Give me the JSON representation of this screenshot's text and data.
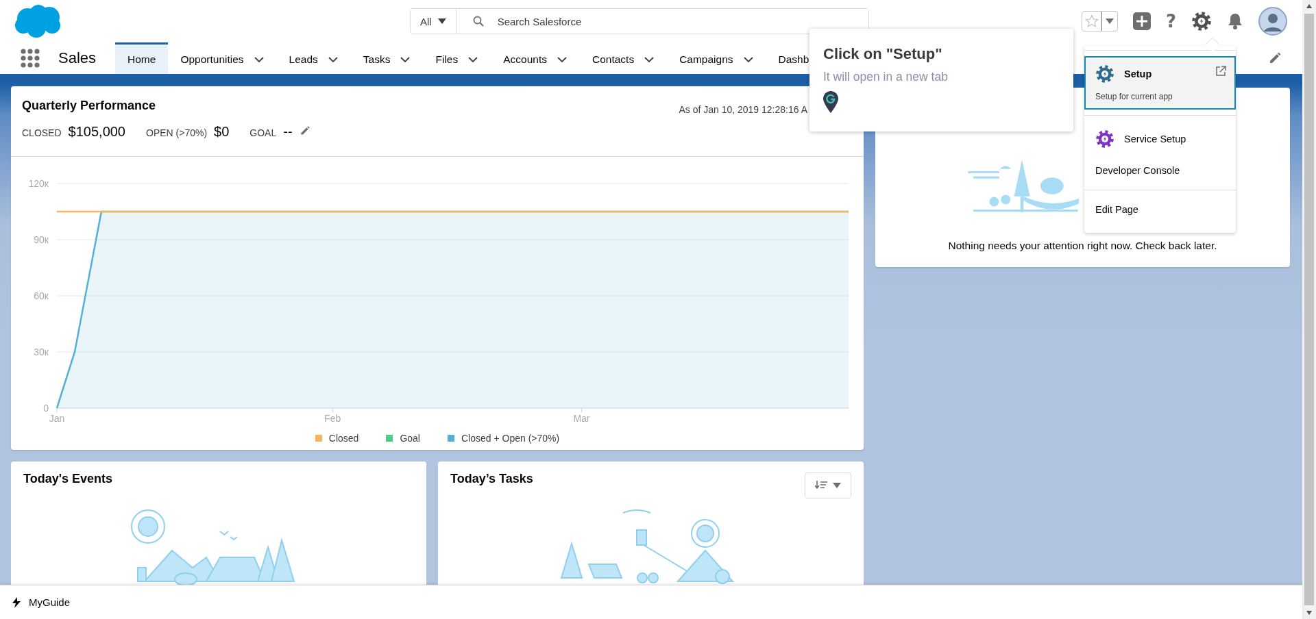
{
  "header": {
    "search_scope": "All",
    "search_placeholder": "Search Salesforce",
    "help_label": "?"
  },
  "nav": {
    "app_name": "Sales",
    "tabs": [
      {
        "label": "Home",
        "selected": true,
        "has_menu": false
      },
      {
        "label": "Opportunities",
        "selected": false,
        "has_menu": true
      },
      {
        "label": "Leads",
        "selected": false,
        "has_menu": true
      },
      {
        "label": "Tasks",
        "selected": false,
        "has_menu": true
      },
      {
        "label": "Files",
        "selected": false,
        "has_menu": true
      },
      {
        "label": "Accounts",
        "selected": false,
        "has_menu": true
      },
      {
        "label": "Contacts",
        "selected": false,
        "has_menu": true
      },
      {
        "label": "Campaigns",
        "selected": false,
        "has_menu": true
      },
      {
        "label": "Dashb",
        "selected": false,
        "has_menu": false
      }
    ]
  },
  "quarterly_performance": {
    "title": "Quarterly Performance",
    "as_of": "As of Jan 10, 2019 12:28:16 A",
    "metrics": [
      {
        "label": "CLOSED",
        "value": "$105,000",
        "editable": false
      },
      {
        "label": "OPEN (>70%)",
        "value": "$0",
        "editable": false
      },
      {
        "label": "GOAL",
        "value": "--",
        "editable": true
      }
    ],
    "chart_data": {
      "type": "line",
      "grid": true,
      "legend": true,
      "categories": [
        "Jan",
        null,
        null,
        null,
        null,
        null,
        null,
        null,
        null,
        null,
        null,
        null,
        null,
        null,
        null,
        null,
        null,
        null,
        null,
        null,
        null,
        null,
        null,
        null,
        null,
        null,
        null,
        null,
        null,
        null,
        null,
        "Feb",
        null,
        null,
        null,
        null,
        null,
        null,
        null,
        null,
        null,
        null,
        null,
        null,
        null,
        null,
        null,
        null,
        null,
        null,
        null,
        null,
        null,
        null,
        null,
        null,
        null,
        null,
        null,
        "Mar",
        null,
        null,
        null,
        null,
        null,
        null,
        null,
        null,
        null,
        null,
        null,
        null,
        null,
        null,
        null,
        null,
        null,
        null,
        null,
        null,
        null,
        null,
        null,
        null,
        null,
        null,
        null,
        null,
        null,
        null
      ],
      "series": [
        {
          "name": "Closed",
          "color": "#f4b660",
          "values": [
            105,
            105,
            105,
            105,
            105,
            105,
            105,
            105,
            105,
            105,
            105,
            105,
            105,
            105,
            105,
            105,
            105,
            105,
            105,
            105,
            105,
            105,
            105,
            105,
            105,
            105,
            105,
            105,
            105,
            105,
            105,
            105,
            105,
            105,
            105,
            105,
            105,
            105,
            105,
            105,
            105,
            105,
            105,
            105,
            105,
            105,
            105,
            105,
            105,
            105,
            105,
            105,
            105,
            105,
            105,
            105,
            105,
            105,
            105,
            105,
            105,
            105,
            105,
            105,
            105,
            105,
            105,
            105,
            105,
            105,
            105,
            105,
            105,
            105,
            105,
            105,
            105,
            105,
            105,
            105,
            105,
            105,
            105,
            105,
            105,
            105,
            105,
            105,
            105,
            105
          ]
        },
        {
          "name": "Goal",
          "color": "#4bca81",
          "values": [
            null,
            null,
            null,
            null,
            null,
            null,
            null,
            null,
            null,
            null,
            null,
            null,
            null,
            null,
            null,
            null,
            null,
            null,
            null,
            null,
            null,
            null,
            null,
            null,
            null,
            null,
            null,
            null,
            null,
            null,
            null,
            null,
            null,
            null,
            null,
            null,
            null,
            null,
            null,
            null,
            null,
            null,
            null,
            null,
            null,
            null,
            null,
            null,
            null,
            null,
            null,
            null,
            null,
            null,
            null,
            null,
            null,
            null,
            null,
            null,
            null,
            null,
            null,
            null,
            null,
            null,
            null,
            null,
            null,
            null,
            null,
            null,
            null,
            null,
            null,
            null,
            null,
            null,
            null,
            null,
            null,
            null,
            null,
            null,
            null,
            null,
            null,
            null,
            null,
            null
          ]
        },
        {
          "name": "Closed + Open (>70%)",
          "type": "area",
          "color": "#54b0d4",
          "values": [
            0,
            15,
            30,
            55,
            80,
            105,
            105,
            105,
            105,
            105,
            105,
            105,
            105,
            105,
            105,
            105,
            105,
            105,
            105,
            105,
            105,
            105,
            105,
            105,
            105,
            105,
            105,
            105,
            105,
            105,
            105,
            105,
            105,
            105,
            105,
            105,
            105,
            105,
            105,
            105,
            105,
            105,
            105,
            105,
            105,
            105,
            105,
            105,
            105,
            105,
            105,
            105,
            105,
            105,
            105,
            105,
            105,
            105,
            105,
            105,
            105,
            105,
            105,
            105,
            105,
            105,
            105,
            105,
            105,
            105,
            105,
            105,
            105,
            105,
            105,
            105,
            105,
            105,
            105,
            105,
            105,
            105,
            105,
            105,
            105,
            105,
            105,
            105,
            105,
            105
          ]
        }
      ],
      "ylim": [
        0,
        120
      ],
      "yticks": [
        {
          "value": 0,
          "label": "0"
        },
        {
          "value": 30,
          "label": "30к"
        },
        {
          "value": 60,
          "label": "60к"
        },
        {
          "value": 90,
          "label": "90к"
        },
        {
          "value": 120,
          "label": "120к"
        }
      ]
    }
  },
  "assistant": {
    "message": "Nothing needs your attention right now. Check back later."
  },
  "todays_events": {
    "title": "Today's Events"
  },
  "todays_tasks": {
    "title": "Today’s Tasks"
  },
  "tooltip": {
    "title": "Click on \"Setup\"",
    "text": "It will open in a new tab"
  },
  "setup_menu": {
    "sections": [
      {
        "items": [
          {
            "kind": "app",
            "label": "Setup",
            "subtitle": "Setup for current app",
            "color": "#2e6a8c",
            "selected": true,
            "external": true
          }
        ]
      },
      {
        "items": [
          {
            "kind": "app",
            "label": "Service Setup",
            "color": "#7a33c2",
            "selected": false,
            "external": false
          },
          {
            "kind": "link",
            "label": "Developer Console",
            "selected": false
          }
        ]
      },
      {
        "items": [
          {
            "kind": "link",
            "label": "Edit Page",
            "selected": false
          }
        ]
      }
    ]
  },
  "footer": {
    "label": "MyGuide"
  }
}
